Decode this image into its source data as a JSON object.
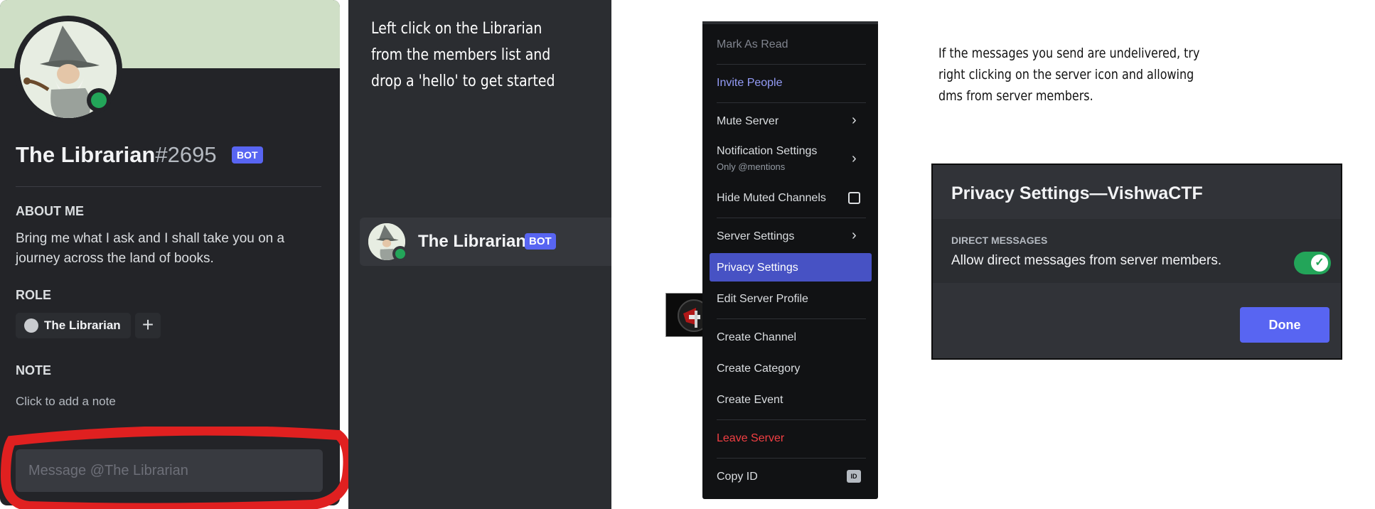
{
  "profile": {
    "name": "The Librarian",
    "discriminator": "#2695",
    "bot_tag": "BOT",
    "about_heading": "ABOUT ME",
    "about_text": "Bring me what I ask and I shall take you on a journey across the land of books.",
    "role_heading": "ROLE",
    "role_name": "The Librarian",
    "add_role": "+",
    "note_heading": "NOTE",
    "note_hint": "Click to add a note",
    "message_placeholder": "Message @The Librarian",
    "status": "online"
  },
  "instruction": {
    "line1": "Left click on the Librarian",
    "line2": "from the members list and",
    "line3": "drop a 'hello' to get started"
  },
  "member_list": {
    "name": "The Librarian",
    "bot_tag": "BOT"
  },
  "context_menu": {
    "mark_as_read": "Mark As Read",
    "invite_people": "Invite People",
    "mute_server": "Mute Server",
    "notification_settings": "Notification Settings",
    "notification_sub": "Only @mentions",
    "hide_muted_channels": "Hide Muted Channels",
    "server_settings": "Server Settings",
    "privacy_settings": "Privacy Settings",
    "edit_server_profile": "Edit Server Profile",
    "create_channel": "Create Channel",
    "create_category": "Create Category",
    "create_event": "Create Event",
    "leave_server": "Leave Server",
    "copy_id": "Copy ID",
    "id_badge": "ID"
  },
  "hint": {
    "line1": "If the messages you send are undelivered, try",
    "line2": "right clicking on the server icon and allowing",
    "line3": "dms from server members."
  },
  "privacy_modal": {
    "title": "Privacy Settings—VishwaCTF",
    "section_heading": "DIRECT MESSAGES",
    "toggle_label": "Allow direct messages from server members.",
    "toggle_on": true,
    "done_label": "Done"
  },
  "colors": {
    "accent": "#5865f2",
    "online": "#23a559",
    "danger": "#f23f43",
    "highlight_annotation": "#e02020"
  }
}
